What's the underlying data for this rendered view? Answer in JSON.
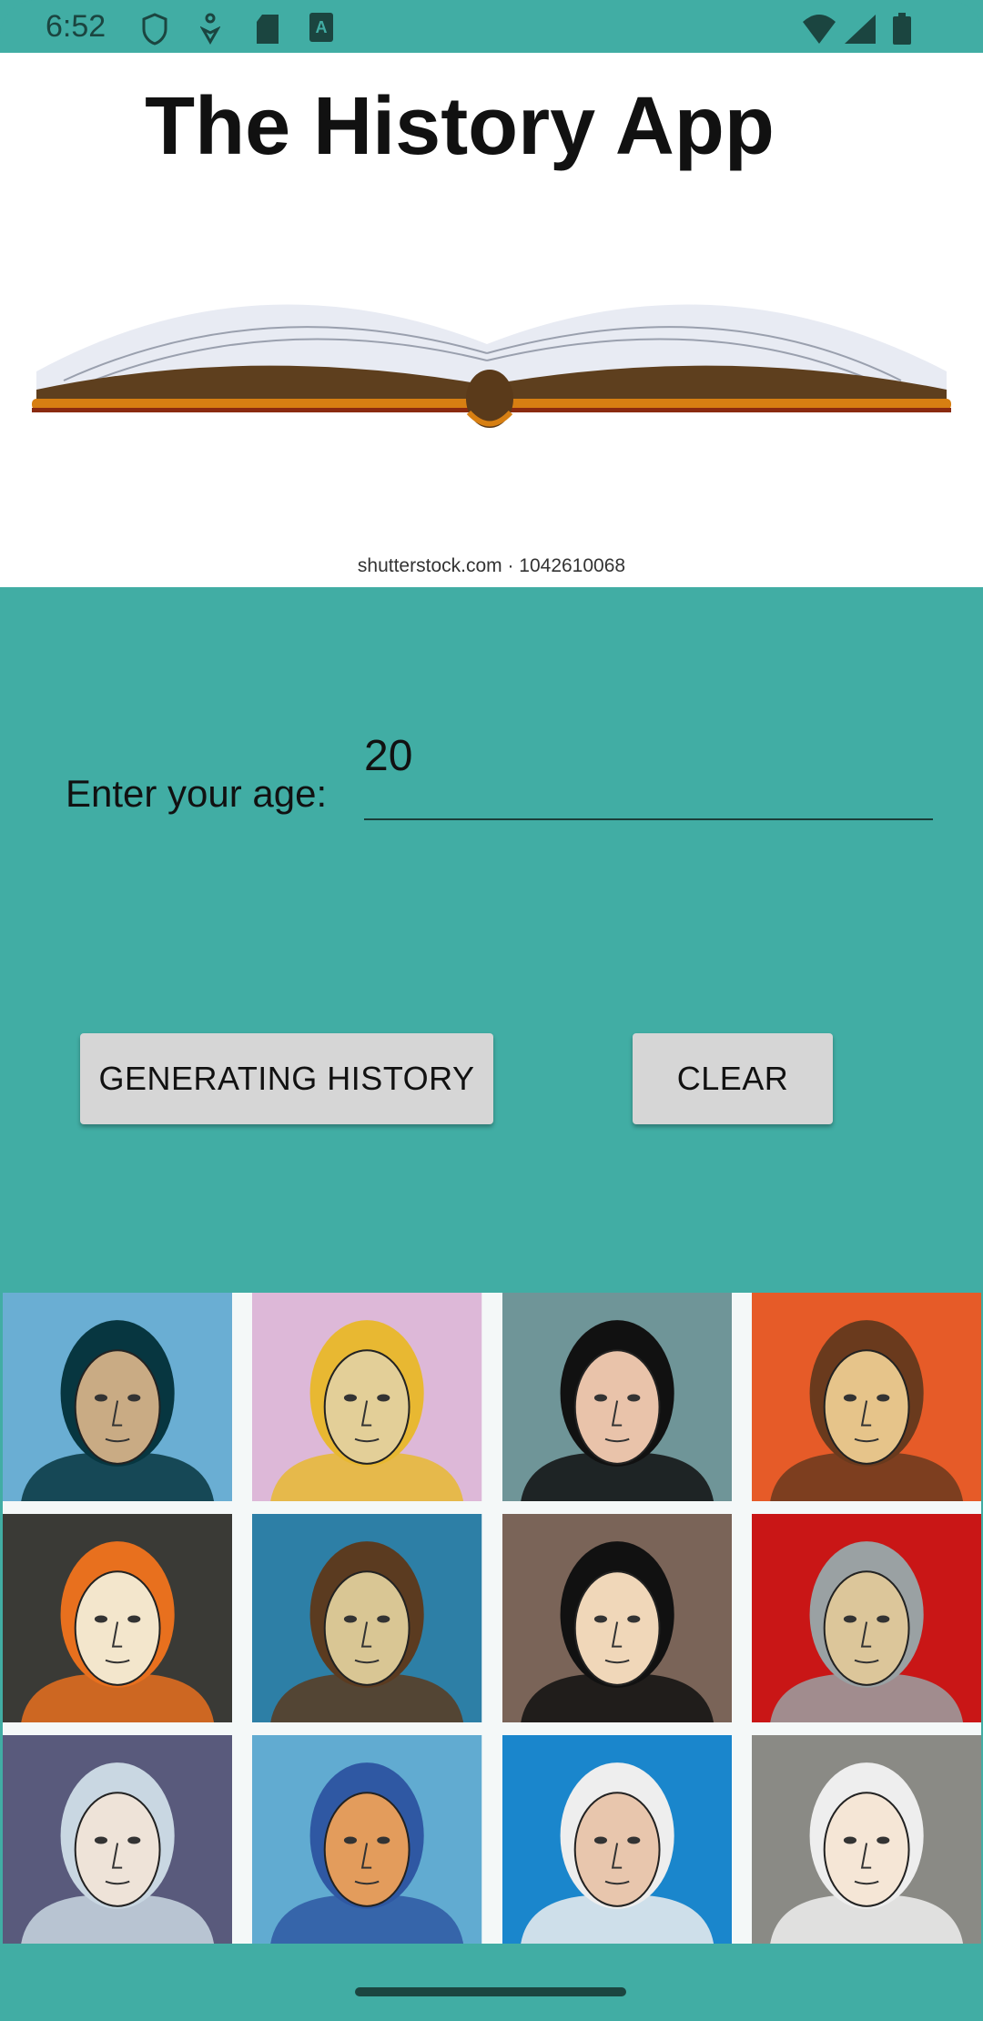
{
  "status_bar": {
    "time": "6:52",
    "icons": [
      "shield-icon",
      "accessibility-icon",
      "sd-card-icon",
      "font-a-icon",
      "wifi-icon",
      "signal-icon",
      "battery-icon"
    ]
  },
  "header": {
    "title": "The History App",
    "watermark": "shutterstock.com · 1042610068"
  },
  "form": {
    "age_label": "Enter your age:",
    "age_value": "20"
  },
  "buttons": {
    "generate": "GENERATING HISTORY",
    "clear": "CLEAR"
  },
  "colors": {
    "accent": "#41ada4",
    "button": "#d6d6d6"
  },
  "portraits": [
    {
      "bg": "#6aaed3",
      "skin": "#c9ab84",
      "hair": "#073640"
    },
    {
      "bg": "#ddb8d8",
      "skin": "#e3cf98",
      "hair": "#e8b832"
    },
    {
      "bg": "#6f9598",
      "skin": "#e9c3aa",
      "hair": "#111"
    },
    {
      "bg": "#e65b28",
      "skin": "#e6c48a",
      "hair": "#6a3a1d"
    },
    {
      "bg": "#3a3a36",
      "skin": "#f3e6cc",
      "hair": "#e8701e"
    },
    {
      "bg": "#2d7fa6",
      "skin": "#d9c694",
      "hair": "#5b3b20"
    },
    {
      "bg": "#7a6458",
      "skin": "#f0d7b9",
      "hair": "#111"
    },
    {
      "bg": "#c91616",
      "skin": "#dcc69a",
      "hair": "#9aa1a3"
    },
    {
      "bg": "#595a7c",
      "skin": "#eee3d8",
      "hair": "#c9d7e2"
    },
    {
      "bg": "#61abd1",
      "skin": "#e39c5c",
      "hair": "#2f58a3"
    },
    {
      "bg": "#1a86cc",
      "skin": "#e8c6ad",
      "hair": "#eee"
    },
    {
      "bg": "#8a8a85",
      "skin": "#f5e6d6",
      "hair": "#eee"
    }
  ]
}
